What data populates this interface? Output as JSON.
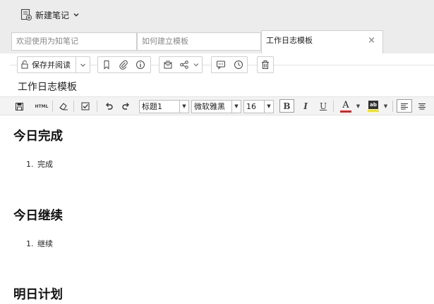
{
  "topbar": {
    "new_note_label": "新建笔记"
  },
  "tabs": [
    {
      "label": "欢迎使用为知笔记"
    },
    {
      "label": "如何建立模板"
    },
    {
      "label": "工作日志模板",
      "close": "×"
    }
  ],
  "actions": {
    "save_read_label": "保存并阅读"
  },
  "note": {
    "title": "工作日志模板"
  },
  "format": {
    "html_label": "HTML",
    "heading_value": "标题1",
    "font_value": "微软雅黑",
    "size_value": "16",
    "bold_label": "B",
    "italic_label": "I",
    "underline_label": "U",
    "font_color_label": "A",
    "highlight_label": "ab",
    "font_color": "#e02020",
    "highlight_color": "#f5e400"
  },
  "content": {
    "sections": [
      {
        "heading": "今日完成",
        "items": [
          {
            "num": "1.",
            "text": "完成"
          }
        ]
      },
      {
        "heading": "今日继续",
        "items": [
          {
            "num": "1.",
            "text": "继续"
          }
        ]
      },
      {
        "heading": "明日计划",
        "items": []
      }
    ]
  }
}
